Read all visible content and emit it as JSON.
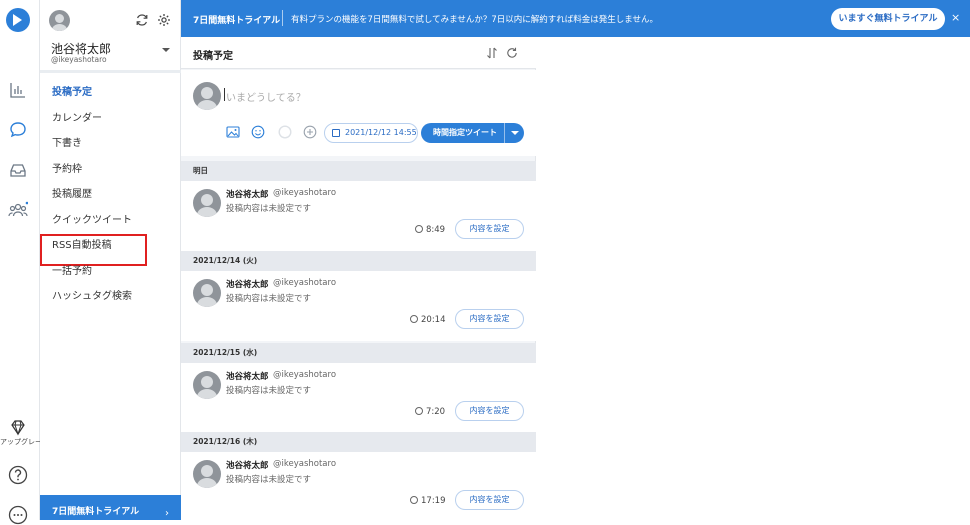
{
  "rail": {
    "upgrade_label": "アップグレード",
    "icons": [
      "logo-icon",
      "chart-icon",
      "chat-icon",
      "inbox-icon",
      "users-icon",
      "diamond-icon",
      "help-icon",
      "more-icon"
    ]
  },
  "account": {
    "name": "池谷将太郎",
    "handle": "@ikeyashotaro"
  },
  "nav": {
    "items": [
      {
        "label": "投稿予定",
        "active": true
      },
      {
        "label": "カレンダー"
      },
      {
        "label": "下書き"
      },
      {
        "label": "予約枠"
      },
      {
        "label": "投稿履歴"
      },
      {
        "label": "クイックツイート"
      },
      {
        "label": "RSS自動投稿",
        "highlighted": true
      },
      {
        "label": "一括予約"
      },
      {
        "label": "ハッシュタグ検索"
      }
    ]
  },
  "sidebar_trial": {
    "label": "7日間無料トライアル",
    "arrow": "›"
  },
  "banner": {
    "title": "7日間無料トライアル",
    "message": "有料プランの機能を7日間無料で試してみませんか？7日以内に解約すれば料金は発生しません。",
    "button": "いますぐ無料トライアル",
    "close": "×"
  },
  "panel": {
    "title": "投稿予定"
  },
  "composer": {
    "placeholder": "いまどうしてる？",
    "datetime": "2021/12/12 14:55",
    "tweet_button": "時間指定ツイート"
  },
  "groups": [
    {
      "date": "明日",
      "posts": [
        {
          "name": "池谷将太郎",
          "handle": "@ikeyashotaro",
          "body": "投稿内容は未設定です",
          "time": "8:49",
          "action": "内容を設定"
        }
      ]
    },
    {
      "date": "2021/12/14 (火)",
      "posts": [
        {
          "name": "池谷将太郎",
          "handle": "@ikeyashotaro",
          "body": "投稿内容は未設定です",
          "time": "20:14",
          "action": "内容を設定"
        }
      ]
    },
    {
      "date": "2021/12/15 (水)",
      "posts": [
        {
          "name": "池谷将太郎",
          "handle": "@ikeyashotaro",
          "body": "投稿内容は未設定です",
          "time": "7:20",
          "action": "内容を設定"
        }
      ]
    },
    {
      "date": "2021/12/16 (木)",
      "posts": [
        {
          "name": "池谷将太郎",
          "handle": "@ikeyashotaro",
          "body": "投稿内容は未設定です",
          "time": "17:19",
          "action": "内容を設定"
        }
      ]
    }
  ],
  "colors": {
    "accent": "#2c7fd8",
    "highlight_box": "#e02020",
    "date_bar": "#e6e9ee"
  }
}
